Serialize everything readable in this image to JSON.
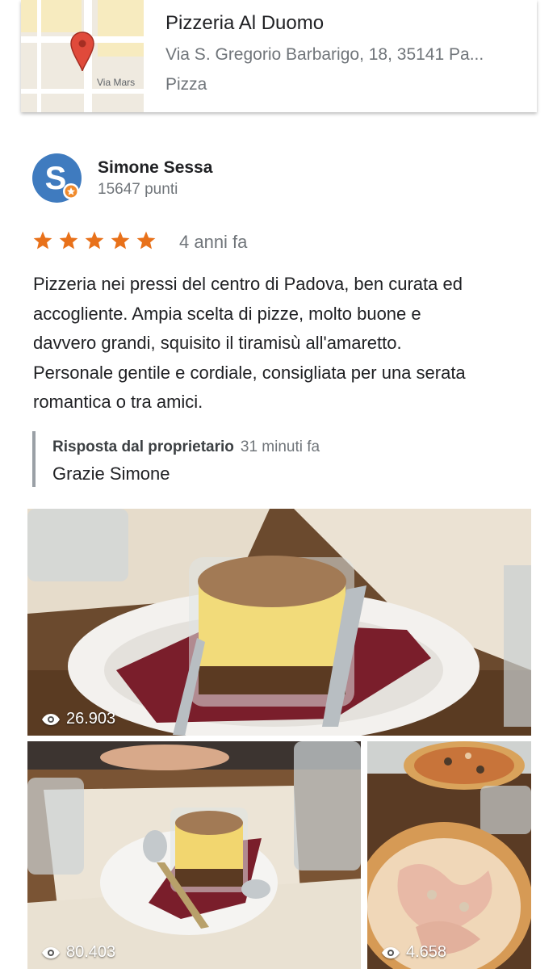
{
  "place": {
    "name": "Pizzeria Al Duomo",
    "address": "Via S. Gregorio Barbarigo, 18, 35141 Pa...",
    "category": "Pizza",
    "map_label": "Via Mars"
  },
  "review": {
    "reviewer_name": "Simone Sessa",
    "reviewer_points": "15647 punti",
    "avatar_letter": "S",
    "rating": 5,
    "age": "4 anni fa",
    "lines": [
      "Pizzeria nei pressi del centro di Padova, ben curata ed",
      "accogliente. Ampia scelta di pizze, molto buone e",
      "davvero grandi, squisito il tiramisù all'amaretto.",
      "Personale gentile e cordiale, consigliata per una serata",
      "romantica o tra amici."
    ]
  },
  "owner_reply": {
    "title": "Risposta dal proprietario",
    "time": "31 minuti fa",
    "text": "Grazie Simone"
  },
  "photos": [
    {
      "views": "26.903",
      "subject": "tiramisu in glass on plate"
    },
    {
      "views": "80.403",
      "subject": "tiramisu on table"
    },
    {
      "views": "4.658",
      "subject": "pizzas"
    }
  ],
  "colors": {
    "star": "#e8711a",
    "avatar_bg": "#3f7bbf",
    "reply_border": "#9aa0a6",
    "map_pin": "#e04a3b"
  },
  "icons": {
    "star": "star-icon",
    "views": "eye-icon",
    "pin": "map-pin-icon"
  }
}
